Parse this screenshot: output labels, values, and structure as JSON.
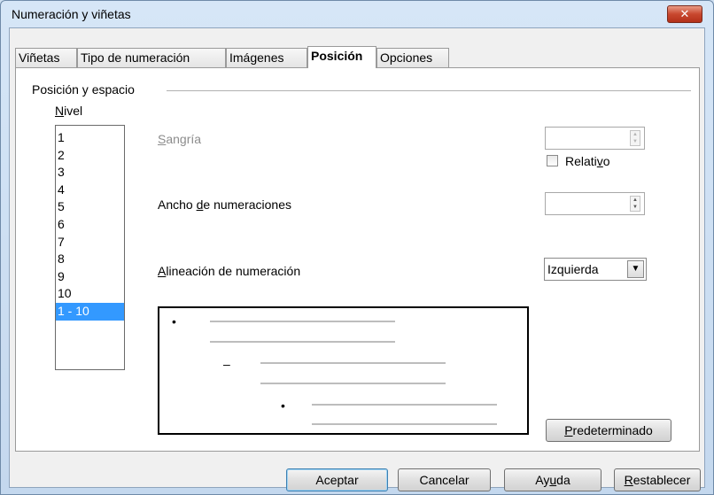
{
  "window": {
    "title": "Numeración y viñetas",
    "close_glyph": "✕"
  },
  "tabs": [
    {
      "label": "Viñetas"
    },
    {
      "label": "Tipo de numeración"
    },
    {
      "label": "Imágenes"
    },
    {
      "label": "Posición",
      "active": true
    },
    {
      "label": "Opciones"
    }
  ],
  "group": {
    "label": "Posición y espacio"
  },
  "level": {
    "label_prefix": "",
    "label_mnemonic": "N",
    "label_rest": "ivel",
    "items": [
      "1",
      "2",
      "3",
      "4",
      "5",
      "6",
      "7",
      "8",
      "9",
      "10",
      "1 - 10"
    ],
    "selected": "1 - 10"
  },
  "indent": {
    "label_mnemonic": "S",
    "label_rest": "angría",
    "value": ""
  },
  "relative": {
    "label_prefix": "Relati",
    "label_mnemonic": "v",
    "label_rest": "o",
    "checked": false
  },
  "numbering_width": {
    "label_prefix": "Ancho ",
    "label_mnemonic": "d",
    "label_rest": "e numeraciones",
    "value": ""
  },
  "alignment": {
    "label_mnemonic": "A",
    "label_rest": "lineación de numeración",
    "value": "Izquierda"
  },
  "preview": {
    "level1_bullet": "•",
    "level2_bullet": "–",
    "level3_bullet": "•"
  },
  "buttons": {
    "default_prefix": "",
    "default_mnemonic": "P",
    "default_rest": "redeterminado",
    "ok": "Aceptar",
    "cancel": "Cancelar",
    "help_prefix": "Ay",
    "help_mnemonic": "u",
    "help_rest": "da",
    "reset_prefix": "",
    "reset_mnemonic": "R",
    "reset_rest": "establecer"
  },
  "colors": {
    "selection": "#3399ff",
    "disabled_text": "#8c8c8c",
    "close_button": "#c8472e"
  }
}
